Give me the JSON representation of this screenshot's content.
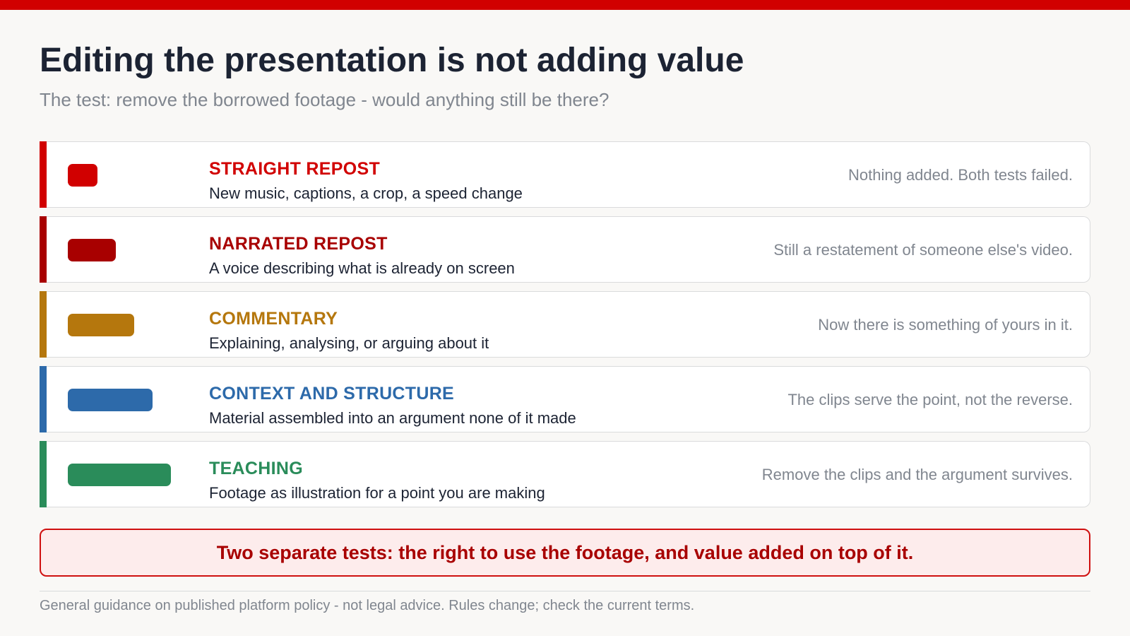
{
  "title": "Editing the presentation is not adding value",
  "subtitle": "The test: remove the borrowed footage - would anything still be there?",
  "rows": [
    {
      "label": "STRAIGHT REPOST",
      "description": "New music, captions, a crop, a speed change",
      "verdict": "Nothing added. Both tests failed.",
      "color": "#d10000",
      "level": 1
    },
    {
      "label": "NARRATED REPOST",
      "description": "A voice describing what is already on screen",
      "verdict": "Still a restatement of someone else's video.",
      "color": "#a80000",
      "level": 2
    },
    {
      "label": "COMMENTARY",
      "description": "Explaining, analysing, or arguing about it",
      "verdict": "Now there is something of yours in it.",
      "color": "#b5770d",
      "level": 3
    },
    {
      "label": "CONTEXT AND STRUCTURE",
      "description": "Material assembled into an argument none of it made",
      "verdict": "The clips serve the point, not the reverse.",
      "color": "#2d6aaa",
      "level": 4
    },
    {
      "label": "TEACHING",
      "description": "Footage as illustration for a point you are making",
      "verdict": "Remove the clips and the argument survives.",
      "color": "#2a8c5a",
      "level": 5
    }
  ],
  "callout": "Two separate tests: the right to use the footage, and value added on top of it.",
  "footnote": "General guidance on published platform policy - not legal advice. Rules change; check the current terms."
}
